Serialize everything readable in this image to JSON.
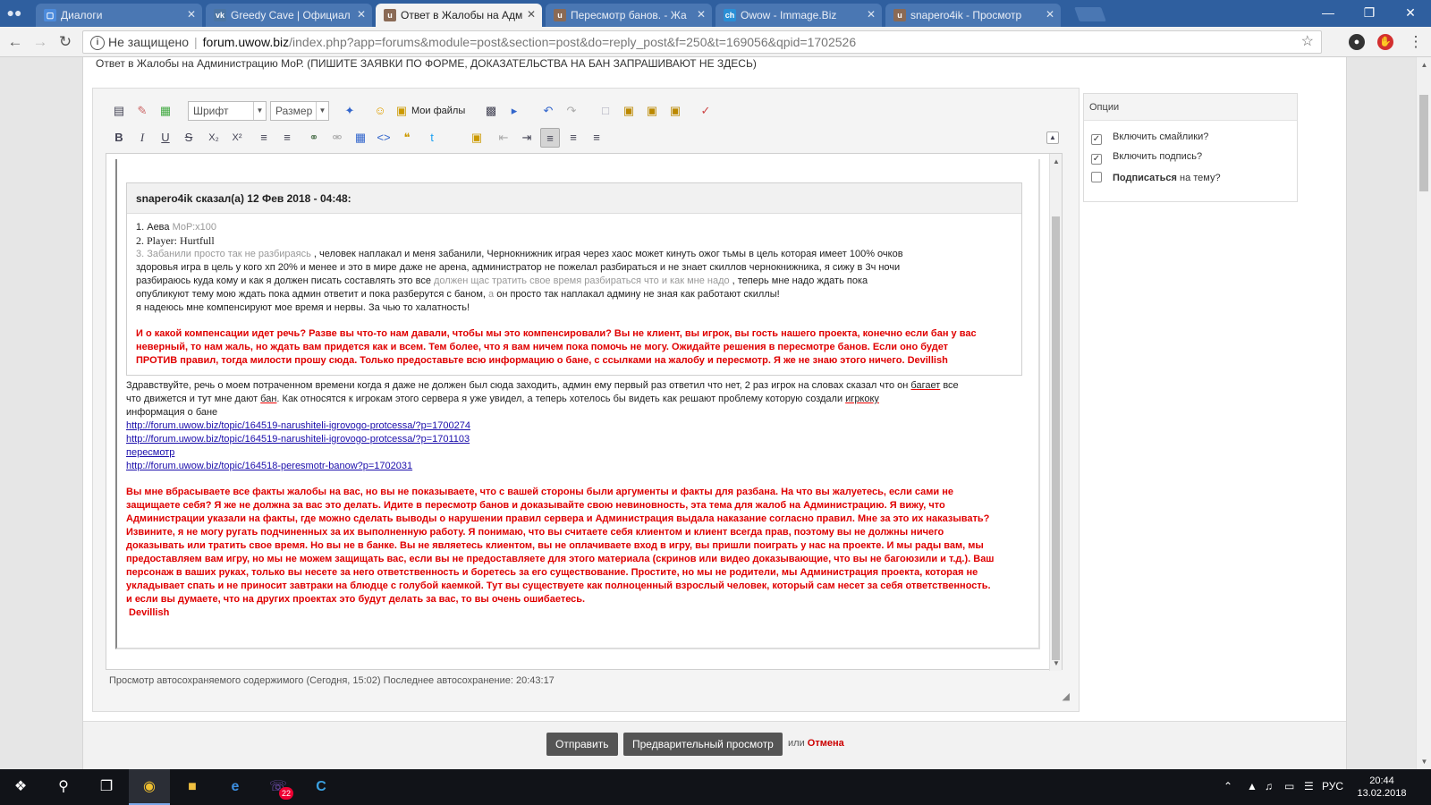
{
  "browser": {
    "tabs": [
      {
        "title": "Диалоги",
        "icon": "vk-message-icon"
      },
      {
        "title": "Greedy Cave | Официал",
        "icon": "vk-icon"
      },
      {
        "title": "Ответ в Жалобы на Адм",
        "icon": "uwow-icon"
      },
      {
        "title": "Пересмотр банов. - Жа",
        "icon": "uwow-icon"
      },
      {
        "title": "Owow - Immage.Biz",
        "icon": "ch-icon"
      },
      {
        "title": "snapero4ik - Просмотр",
        "icon": "uwow-icon"
      }
    ],
    "address": {
      "security": "Не защищено",
      "host": "forum.uwow.biz",
      "path": "/index.php?app=forums&module=post&section=post&do=reply_post&f=250&t=169056&qpid=1702526"
    }
  },
  "page": {
    "title": "Ответ в Жалобы на Администрацию МоР.  (ПИШИТЕ ЗАЯВКИ ПО ФОРМЕ, ДОКАЗАТЕЛЬСТВА НА БАН ЗАПРАШИВАЮТ НЕ ЗДЕСЬ)"
  },
  "toolbar": {
    "font_label": "Шрифт",
    "size_label": "Размер",
    "my_files": "Мои файлы"
  },
  "quote": {
    "header": "snapero4ik сказал(а) 12 Фев 2018 - 04:48:",
    "l1_name": "1. Аева",
    "l1_grey": "МоР:x100",
    "l2": "2.  Player: Hurtfull",
    "l3_grey": "3. Забанили просто так не разбираясь",
    "l3_rest": " ,  человек наплакал и меня забанили, Чернокнижник играя через хаос может кинуть ожог тьмы  в цель которая имеет 100% очков",
    "l4": "здоровья игра в цель у кого хп 20% и менее  и это в мире даже не арена, администратор не пожелал разбираться и не знает скиллов чернокнижника, я сижу в 3ч ночи",
    "l5_a": "разбираюсь куда кому и как я должен писать составлять это все",
    "l5_grey": " должен щас тратить свое время разбираться что и как мне надо",
    "l5_b": " , теперь мне надо ждать пока",
    "l6_a": "опубликуют тему мою ждать пока админ ответит и пока разберутся с баном,",
    "l6_grey": " а",
    "l6_b": " он просто так наплакал админу не зная как работают скиллы!",
    "l7": "я надеюсь мне компенсируют мое время и нервы. За чью то халатность!",
    "admin_reply": [
      "И о какой компенсации идет речь? Разве вы что-то нам давали, чтобы мы это компенсировали? Вы не клиент, вы игрок, вы гость нашего проекта, конечно если бан у вас",
      "неверный, то нам жаль, но ждать вам придется как и всем. Тем более, что я вам ничем пока помочь не могу. Ожидайте решения в пересмотре банов. Если оно будет",
      "ПРОТИВ правил, тогда милости прошу сюда. Только предоставьте всю информацию о бане, с ссылками на жалобу и пересмотр. Я же не знаю этого ничего. Devillish"
    ]
  },
  "reply": {
    "r1_a": "Здравствуйте, речь о моем потраченном времени когда я даже не должен был сюда заходить, админ ему первый раз ответил что нет, 2 раз игрок на словах  сказал что он ",
    "r1_sp": "багает",
    "r1_b": " все",
    "r2_a": "что движется и тут мне дают  ",
    "r2_sp1": "бан",
    "r2_b": ". Как относятся к игрокам этого сервера я уже увидел, а теперь хотелось бы видеть как решают проблему которую создали ",
    "r2_sp2": "игркоку",
    "r3": "информация о бане",
    "link1": "http://forum.uwow.biz/topic/164519-narushiteli-igrovogo-protcessa/?p=1700274",
    "link2": "http://forum.uwow.biz/topic/164519-narushiteli-igrovogo-protcessa/?p=1701103",
    "link3": "пересмотр",
    "link4": "http://forum.uwow.biz/topic/164518-peresmotr-banow?p=1702031",
    "admin_reply": [
      "Вы мне вбрасываете все факты жалобы на вас, но вы не показываете, что с вашей стороны были аргументы и факты для разбана. На что вы жалуетесь, если сами не",
      "защищаете себя? Я же не должна за вас это делать. Идите в пересмотр банов и доказывайте свою невиновность, эта тема для жалоб на Администрацию. Я вижу, что",
      "Администрации указали на факты, где можно сделать выводы о нарушении правил сервера и Администрация выдала наказание согласно правил. Мне за это их наказывать?",
      "Извините, я не могу ругать подчиненных за их выполненную работу. Я понимаю, что вы считаете себя клиентом и клиент всегда прав, поэтому вы не должны ничего",
      "доказывать или тратить свое время. Но вы не в банке. Вы не являетесь клиентом, вы не оплачиваете вход в игру, вы пришли поиграть у нас на проекте. И мы рады вам, мы",
      "предоставляем вам игру, но мы не можем защищать вас, если вы не предоставляете для этого материала (скринов или  видео доказывающие, что вы не багоюзили и т.д.). Ваш",
      "персонаж в ваших руках, только вы несете за него ответственность и боретесь за его существование. Простите, но мы не родители, мы Администрация проекта, которая не",
      "укладывает спать и не приносит завтраки на блюдце с голубой каемкой. Тут вы существуете как полноценный взрослый человек, который сам несет за себя ответственность.",
      "и если вы думаете, что на других проектах это будут делать за вас, то вы очень ошибаетесь.",
      " Devillish"
    ]
  },
  "autosave": "Просмотр автосохраняемого содержимого (Сегодня, 15:02)  Последнее автосохранение: 20:43:17",
  "options": {
    "title": "Опции",
    "smilies": "Включить смайлики?",
    "signature": "Включить подпись?",
    "subscribe_bold": "Подписаться",
    "subscribe_rest": " на тему?"
  },
  "form": {
    "submit": "Отправить",
    "preview": "Предварительный просмотр",
    "or": "или",
    "cancel": "Отмена"
  },
  "taskbar": {
    "viber_badge": "22",
    "lang": "РУС",
    "time": "20:44",
    "date": "13.02.2018"
  },
  "colors": {
    "tabstrip": "#2f5f9f",
    "admin_red": "#e00000",
    "link": "#1a0dab",
    "button": "#555555"
  }
}
